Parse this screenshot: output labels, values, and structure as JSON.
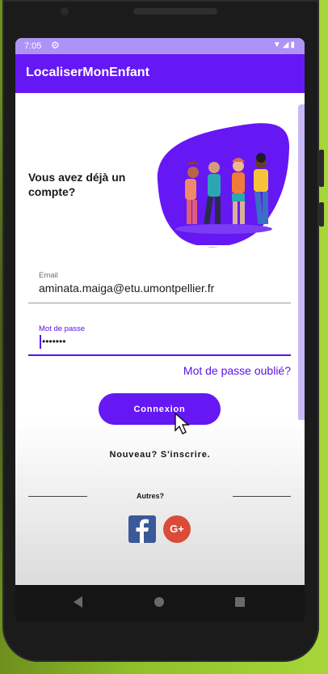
{
  "status_bar": {
    "time": "7:05"
  },
  "app_bar": {
    "title": "LocaliserMonEnfant"
  },
  "login": {
    "heading": "Vous avez déjà un compte?",
    "email": {
      "label": "Email",
      "value": "aminata.maiga@etu.umontpellier.fr"
    },
    "password": {
      "label": "Mot de passe",
      "value": "•••••••"
    },
    "forgot_password": "Mot de passe oublié?",
    "login_button": "Connexion",
    "signup_link": "Nouveau? S'inscrire.",
    "others_label": "Autres?"
  },
  "social": {
    "google_label": "G+"
  },
  "colors": {
    "primary": "#6518f4",
    "status_bar": "#ae93f7",
    "facebook": "#3b5998",
    "google": "#dc4a38"
  }
}
